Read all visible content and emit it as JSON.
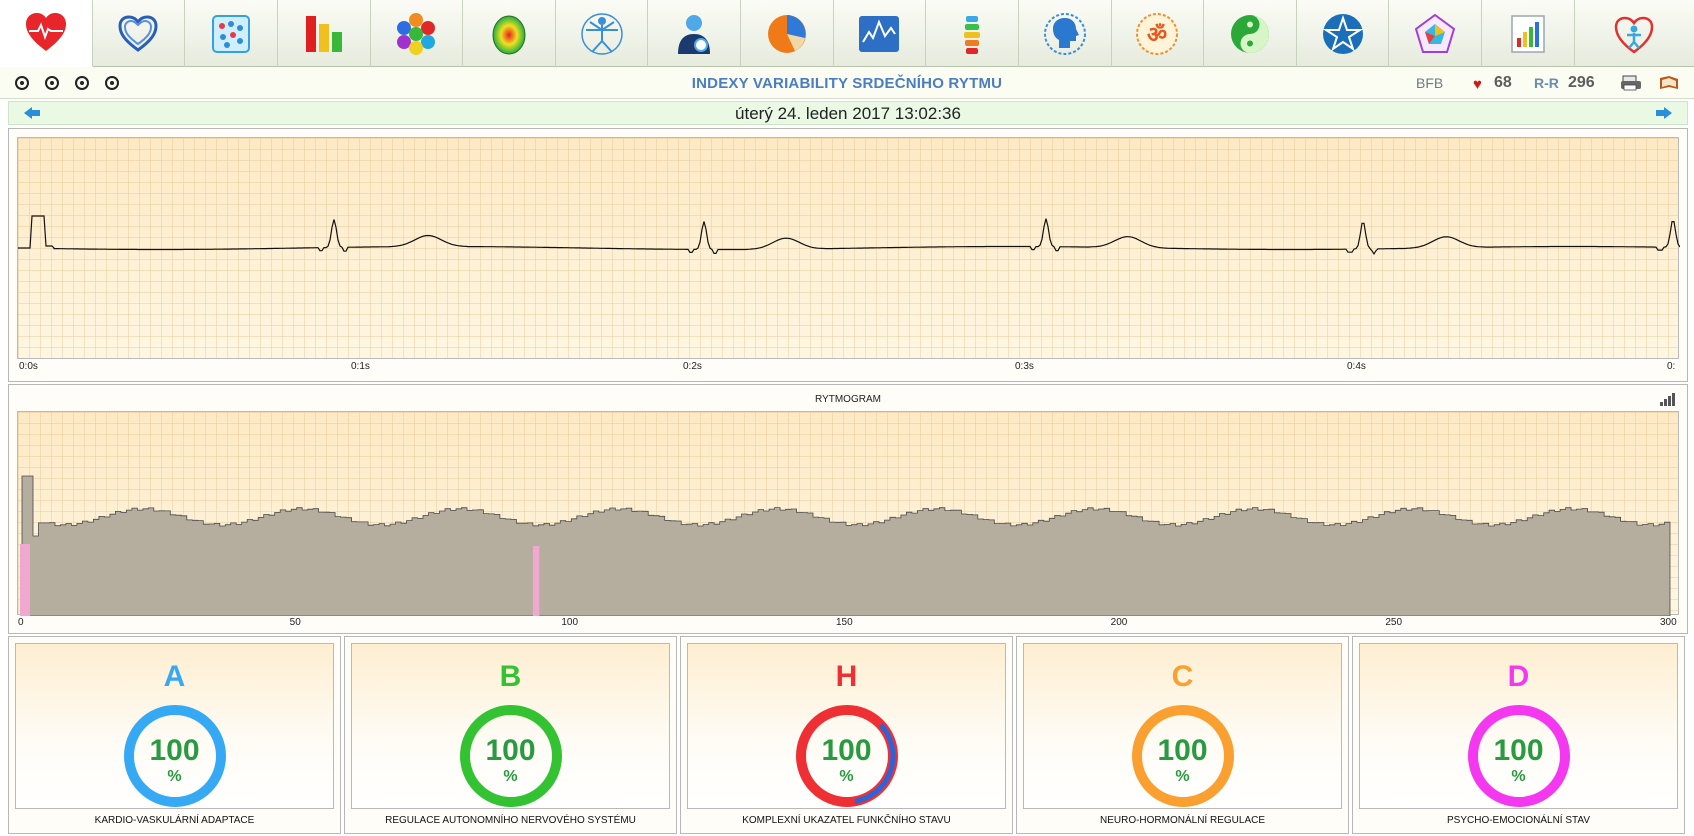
{
  "header": {
    "title": "INDEXY VARIABILITY SRDEČNÍHO RYTMU",
    "bfb_label": "BFB",
    "pulse_value": "68",
    "rr_label": "R-R",
    "rr_value": "296"
  },
  "datebar": {
    "date": "úterý 24. leden 2017 13:02:36"
  },
  "tabs": [
    {
      "icon": "heart-ecg-icon"
    },
    {
      "icon": "heart-outline-icon"
    },
    {
      "icon": "dots-grid-icon"
    },
    {
      "icon": "bar-chart-icon"
    },
    {
      "icon": "hexagon-cluster-icon"
    },
    {
      "icon": "brain-map-icon"
    },
    {
      "icon": "vitruvian-man-icon"
    },
    {
      "icon": "person-avatar-icon"
    },
    {
      "icon": "pie-chart-icon"
    },
    {
      "icon": "line-chart-icon"
    },
    {
      "icon": "spine-icon"
    },
    {
      "icon": "head-profile-icon"
    },
    {
      "icon": "om-symbol-icon"
    },
    {
      "icon": "yin-yang-icon"
    },
    {
      "icon": "star-icon"
    },
    {
      "icon": "pentagon-chart-icon"
    },
    {
      "icon": "report-chart-icon"
    },
    {
      "icon": "heart-person-icon"
    }
  ],
  "ecg": {
    "ticks": [
      "0:0s",
      "0:1s",
      "0:2s",
      "0:3s",
      "0:4s",
      "0:"
    ]
  },
  "rytmogram": {
    "title": "RYTMOGRAM",
    "ticks": [
      "0",
      "50",
      "100",
      "150",
      "200",
      "250",
      "300"
    ]
  },
  "gauges": [
    {
      "letter": "A",
      "value": "100",
      "unit": "%",
      "caption": "KARDIO-VASKULÁRNÍ ADAPTACE",
      "color": "#36a9f5",
      "inner": null
    },
    {
      "letter": "B",
      "value": "100",
      "unit": "%",
      "caption": "REGULACE AUTONOMNÍHO NERVOVÉHO SYSTÉMU",
      "color": "#32c232",
      "inner": null
    },
    {
      "letter": "H",
      "value": "100",
      "unit": "%",
      "caption": "KOMPLEXNÍ UKAZATEL FUNKČNÍHO STAVU",
      "color": "#ee3034",
      "inner": "#2a64d8"
    },
    {
      "letter": "C",
      "value": "100",
      "unit": "%",
      "caption": "NEURO-HORMONÁLNÍ REGULACE",
      "color": "#f9a030",
      "inner": null
    },
    {
      "letter": "D",
      "value": "100",
      "unit": "%",
      "caption": "PSYCHO-EMOCIONÁLNÍ STAV",
      "color": "#f438f0",
      "inner": null
    }
  ]
}
